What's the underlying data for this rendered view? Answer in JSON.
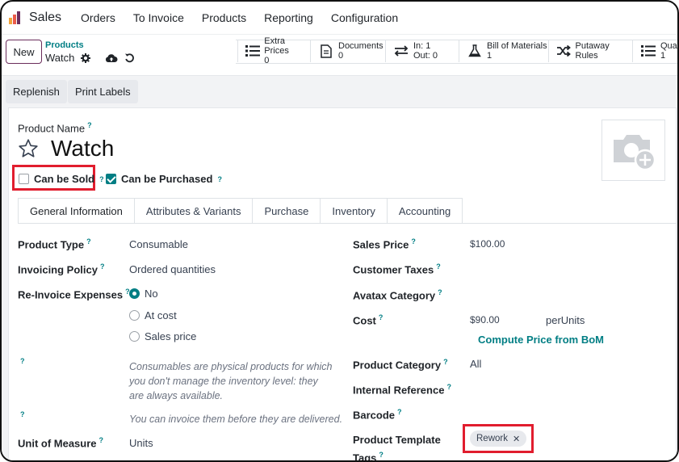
{
  "app": {
    "name": "Sales"
  },
  "nav": {
    "items": [
      "Orders",
      "To Invoice",
      "Products",
      "Reporting",
      "Configuration"
    ]
  },
  "control": {
    "new_label": "New",
    "breadcrumb_parent": "Products",
    "breadcrumb_current": "Watch"
  },
  "smart_buttons": [
    {
      "label": "Extra Prices",
      "value": "0"
    },
    {
      "label": "Documents",
      "value": "0"
    },
    {
      "label": "In: 1",
      "value": "Out: 0"
    },
    {
      "label": "Bill of Materials",
      "value": "1"
    },
    {
      "label": "Putaway Rules",
      "value": ""
    },
    {
      "label": "Quali",
      "value": "1"
    }
  ],
  "actions": {
    "replenish": "Replenish",
    "print_labels": "Print Labels"
  },
  "product": {
    "name_label": "Product Name",
    "help": "?",
    "name": "Watch",
    "can_be_sold_label": "Can be Sold",
    "can_be_sold": false,
    "can_be_purchased_label": "Can be Purchased",
    "can_be_purchased": true
  },
  "tabs": [
    "General Information",
    "Attributes & Variants",
    "Purchase",
    "Inventory",
    "Accounting"
  ],
  "left": {
    "product_type_label": "Product Type",
    "product_type": "Consumable",
    "invoicing_policy_label": "Invoicing Policy",
    "invoicing_policy": "Ordered quantities",
    "reinvoice_label": "Re-Invoice Expenses",
    "reinvoice_options": [
      "No",
      "At cost",
      "Sales price"
    ],
    "reinvoice_selected": "No",
    "help_consumable": "Consumables are physical products for which you don't manage the inventory level: they are always available.",
    "help_invoice": "You can invoice them before they are delivered.",
    "uom_label": "Unit of Measure",
    "uom": "Units"
  },
  "right": {
    "sales_price_label": "Sales Price",
    "sales_price": "$100.00",
    "customer_taxes_label": "Customer Taxes",
    "avatax_label": "Avatax Category",
    "cost_label": "Cost",
    "cost": "$90.00",
    "cost_unit": "perUnits",
    "compute_bom": "Compute Price from BoM",
    "category_label": "Product Category",
    "category": "All",
    "internal_ref_label": "Internal Reference",
    "barcode_label": "Barcode",
    "tags_label_line1": "Product Template",
    "tags_label_line2": "Tags",
    "tag": "Rework",
    "tag_remove": "✕"
  },
  "colors": {
    "accent": "#017e84",
    "brand": "#6b2d5c",
    "highlight": "#e11d2e"
  }
}
